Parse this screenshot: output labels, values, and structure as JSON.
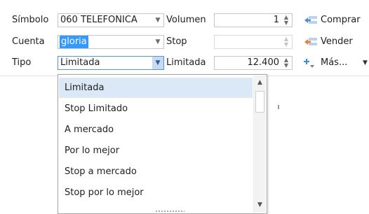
{
  "form": {
    "simbolo_label": "Símbolo",
    "simbolo_value": "060 TELEFONICA",
    "cuenta_label": "Cuenta",
    "cuenta_value": "gloria",
    "tipo_label": "Tipo",
    "tipo_value": "Limitada",
    "volumen_label": "Volumen",
    "volumen_value": "1",
    "stop_label": "Stop",
    "stop_value": "",
    "limitada_label": "Limitada",
    "limitada_value": "12.400"
  },
  "actions": {
    "comprar": "Comprar",
    "vender": "Vender",
    "mas": "Más..."
  },
  "dropdown": {
    "options": [
      "Limitada",
      "Stop Limitado",
      "A mercado",
      "Por lo mejor",
      "Stop a mercado",
      "Stop por lo mejor"
    ],
    "selected": "Limitada"
  },
  "colors": {
    "selection_highlight": "#3399ff",
    "dropdown_selected": "#dbe8f6",
    "buy_icon": "#6fa4d8",
    "sell_icon": "#ef7d3a",
    "more_icon": "#3b8ed1"
  },
  "icons": {
    "combo_arrow": "chevron-down-icon",
    "spin": "spin-up-down-icon",
    "buy": "buy-arrow-icon",
    "sell": "sell-arrow-icon",
    "more": "plus-sort-icon"
  }
}
